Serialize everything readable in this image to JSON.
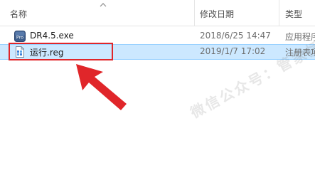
{
  "columns": {
    "name": "名称",
    "modified": "修改日期",
    "type": "类型"
  },
  "files": [
    {
      "name": "DR4.5.exe",
      "modified": "2018/6/25 14:47",
      "type": "应用程序",
      "icon": "pro-exe-icon",
      "icon_text": "Pro"
    },
    {
      "name": "运行.reg",
      "modified": "2019/1/7 17:02",
      "type": "注册表项",
      "icon": "registry-file-icon"
    }
  ],
  "annotation": {
    "color": "#e0262a"
  },
  "watermark": "微信公众号：管家插件"
}
